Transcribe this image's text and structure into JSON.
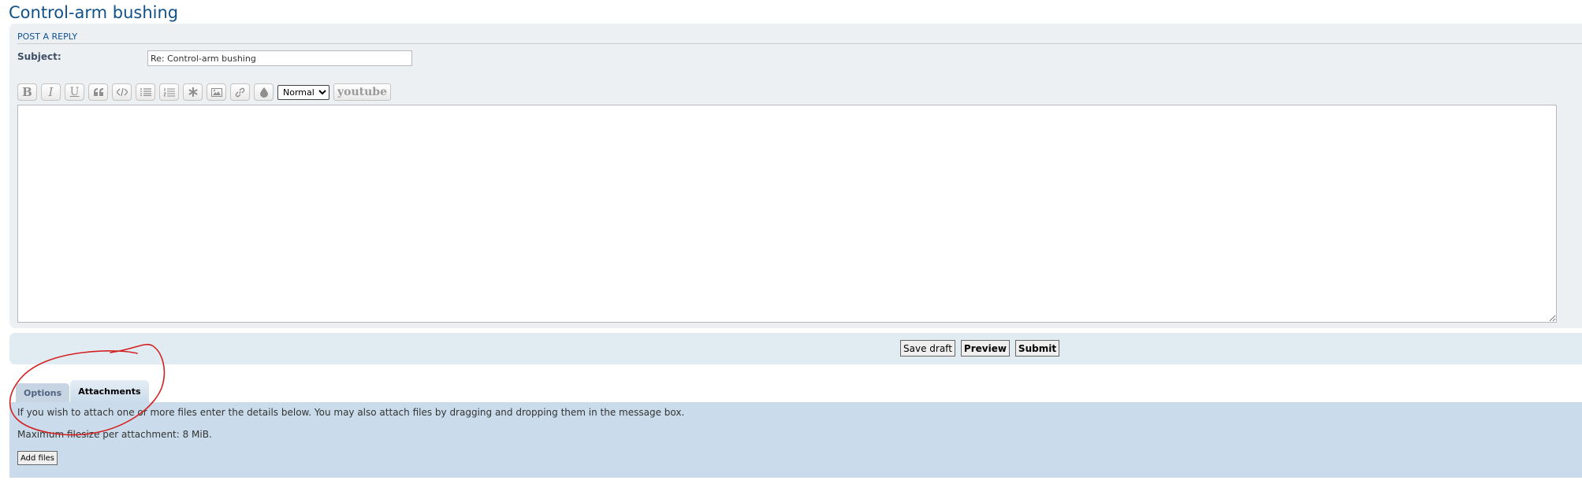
{
  "page": {
    "title": "Control-arm bushing"
  },
  "post_form": {
    "heading": "POST A REPLY",
    "subject_label": "Subject:",
    "subject_value": "Re: Control-arm bushing",
    "toolbar": {
      "bold": "B",
      "italic": "I",
      "underline": "U",
      "font_size_selected": "Normal",
      "youtube": "youtube"
    },
    "message_value": ""
  },
  "actions": {
    "save_draft": "Save draft",
    "preview": "Preview",
    "submit": "Submit"
  },
  "tabs": [
    {
      "label": "Options",
      "active": false
    },
    {
      "label": "Attachments",
      "active": true
    }
  ],
  "attachments": {
    "intro": "If you wish to attach one or more files enter the details below. You may also attach files by dragging and dropping them in the message box.",
    "max_size": "Maximum filesize per attachment: 8 MiB.",
    "add_files": "Add files"
  },
  "colors": {
    "title": "#105289",
    "panel_bg": "#ecf0f3",
    "submit_bar_bg": "#e1ebf2",
    "attach_bg": "#cadceb",
    "annotation": "#d42020"
  }
}
